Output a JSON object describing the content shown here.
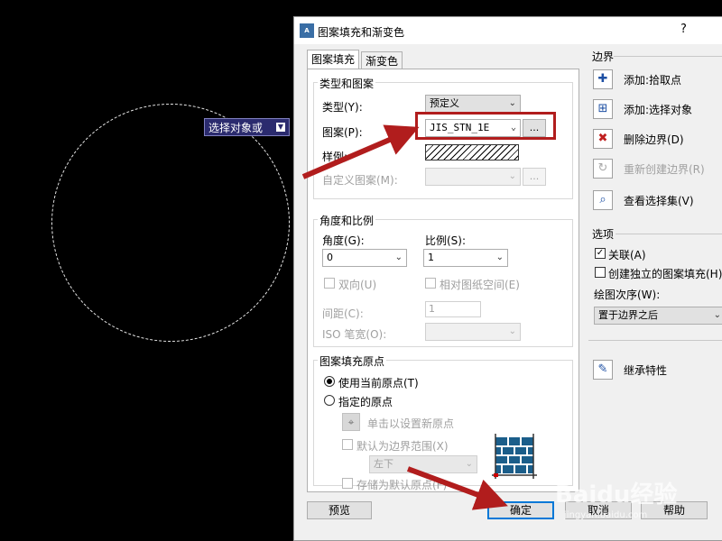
{
  "command_tooltip": {
    "text": "选择对象或",
    "dropdown_icon": "down-arrow-icon"
  },
  "dialog": {
    "title": "图案填充和渐变色",
    "help": "?",
    "app_icon_text": "A",
    "tabs": [
      {
        "label": "图案填充",
        "active": true
      },
      {
        "label": "渐变色",
        "active": false
      }
    ]
  },
  "type_pattern": {
    "group_title": "类型和图案",
    "type_label": "类型(Y):",
    "type_value": "预定义",
    "pattern_label": "图案(P):",
    "pattern_value": "JIS_STN_1E",
    "browse_label": "...",
    "sample_label": "样例:",
    "custom_label": "自定义图案(M):",
    "custom_value": "",
    "custom_browse": "..."
  },
  "angle_scale": {
    "group_title": "角度和比例",
    "angle_label": "角度(G):",
    "angle_value": "0",
    "scale_label": "比例(S):",
    "scale_value": "1",
    "double_label": "双向(U)",
    "relative_label": "相对图纸空间(E)",
    "spacing_label": "间距(C):",
    "spacing_value": "1",
    "iso_label": "ISO 笔宽(O):",
    "iso_value": ""
  },
  "origin": {
    "group_title": "图案填充原点",
    "use_current": "使用当前原点(T)",
    "specified": "指定的原点",
    "click_set": "单击以设置新原点",
    "default_boundary": "默认为边界范围(X)",
    "position_value": "左下",
    "store_default": "存储为默认原点(F)"
  },
  "boundaries": {
    "title": "边界",
    "items": [
      {
        "label": "添加:拾取点",
        "icon": "pick-point-icon",
        "enabled": true
      },
      {
        "label": "添加:选择对象",
        "icon": "select-objects-icon",
        "enabled": true
      },
      {
        "label": "删除边界(D)",
        "icon": "remove-boundary-icon",
        "enabled": true
      },
      {
        "label": "重新创建边界(R)",
        "icon": "recreate-boundary-icon",
        "enabled": false
      },
      {
        "label": "查看选择集(V)",
        "icon": "view-selection-icon",
        "enabled": true
      }
    ]
  },
  "options": {
    "title": "选项",
    "associative": "关联(A)",
    "associative_checked": true,
    "separate": "创建独立的图案填充(H)",
    "separate_checked": false,
    "draw_order_label": "绘图次序(W):",
    "draw_order_value": "置于边界之后"
  },
  "inherit_label": "继承特性",
  "buttons": {
    "preview": "预览",
    "ok": "确定",
    "cancel": "取消",
    "help": "帮助"
  },
  "watermark": {
    "main": "Baidu经验",
    "sub": "jingyan.baidu.com"
  },
  "colors": {
    "annotation_red": "#b11d1d",
    "tooltip_bg": "#2b2b6e",
    "default_button_border": "#0078d7"
  }
}
